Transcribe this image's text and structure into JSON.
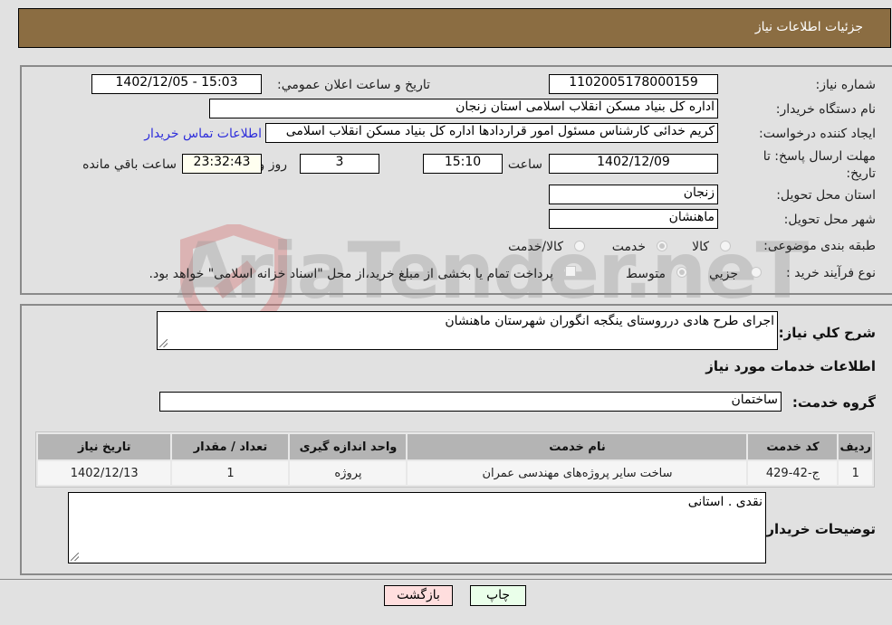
{
  "header": {
    "title": "جزئیات اطلاعات نیاز"
  },
  "form": {
    "need_number": {
      "label": "شماره نیاز:",
      "value": "1102005178000159"
    },
    "announce_datetime": {
      "label": "تاریخ و ساعت اعلان عمومي:",
      "value": "1402/12/05 - 15:03"
    },
    "buyer_org": {
      "label": "نام دستگاه خريدار:",
      "value": "اداره کل بنیاد مسکن انقلاب اسلامی استان زنجان"
    },
    "requester": {
      "label": "ايجاد کننده درخواست:",
      "value": "کریم خدائی کارشناس مسئول امور قراردادها اداره کل بنیاد مسکن انقلاب اسلامی",
      "contact_link": "اطلاعات تماس خريدار"
    },
    "deadline": {
      "label": "مهلت ارسال پاسخ: تا تاریخ:",
      "date": "1402/12/09",
      "time_label": "ساعت",
      "time": "15:10",
      "days": "3",
      "days_label": "روز و",
      "remaining": "23:32:43",
      "remaining_label": "ساعت باقي مانده"
    },
    "province": {
      "label": "استان محل تحویل:",
      "value": "زنجان"
    },
    "city": {
      "label": "شهر محل تحویل:",
      "value": "ماهنشان"
    },
    "category": {
      "label": "طبقه بندی موضوعی:",
      "options": [
        "کالا",
        "خدمت",
        "کالا/خدمت"
      ],
      "selected": "خدمت"
    },
    "purchase_type": {
      "label": "نوع فرآیند خرید :",
      "options": [
        "جزیي",
        "متوسط"
      ],
      "selected": "متوسط",
      "treasury_note": "پرداخت تمام یا بخشی از مبلغ خرید،از محل \"اسناد خزانه اسلامی\" خواهد بود."
    }
  },
  "details": {
    "description_label": "شرح کلي نياز:",
    "description": "اجرای طرح هادی درروستای ینگجه انگوران  شهرستان ماهنشان",
    "services_heading": "اطلاعات خدمات مورد نياز",
    "service_group_label": "گروه خدمت:",
    "service_group": "ساختمان",
    "table": {
      "headers": [
        "ردیف",
        "کد خدمت",
        "نام خدمت",
        "واحد اندازه گیری",
        "تعداد / مقدار",
        "تاریخ نیاز"
      ],
      "rows": [
        [
          "1",
          "ج-42-429",
          "ساخت سایر پروژه‌های مهندسی عمران",
          "پروژه",
          "1",
          "1402/12/13"
        ]
      ]
    },
    "buyer_notes_label": "توضیحات خریدار:",
    "buyer_notes": "نقدی . استانی"
  },
  "buttons": {
    "print": "چاپ",
    "back": "بازگشت"
  },
  "watermark": "AriaTender.neT"
}
